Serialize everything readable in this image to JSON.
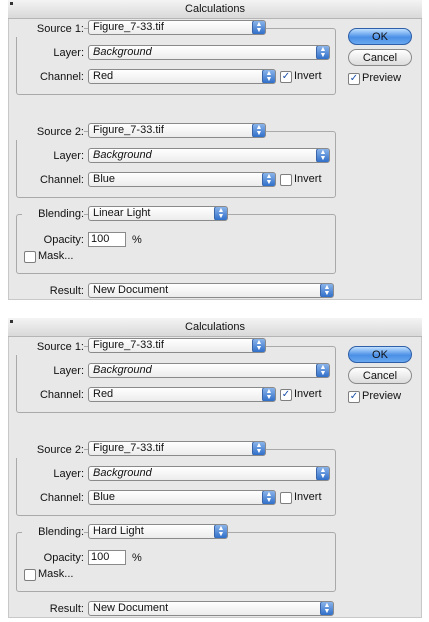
{
  "dialogs": [
    {
      "title": "Calculations",
      "source1": {
        "label": "Source 1:",
        "file": "Figure_7-33.tif",
        "layer_label": "Layer:",
        "layer": "Background",
        "channel_label": "Channel:",
        "channel": "Red",
        "invert_label": "Invert",
        "invert_checked": true
      },
      "source2": {
        "label": "Source 2:",
        "file": "Figure_7-33.tif",
        "layer_label": "Layer:",
        "layer": "Background",
        "channel_label": "Channel:",
        "channel": "Blue",
        "invert_label": "Invert",
        "invert_checked": false
      },
      "blending": {
        "label": "Blending:",
        "mode": "Linear Light",
        "opacity_label": "Opacity:",
        "opacity": "100",
        "percent": "%",
        "mask_label": "Mask...",
        "mask_checked": false
      },
      "result": {
        "label": "Result:",
        "value": "New Document"
      },
      "ok_label": "OK",
      "cancel_label": "Cancel",
      "preview_label": "Preview",
      "preview_checked": true
    },
    {
      "title": "Calculations",
      "source1": {
        "label": "Source 1:",
        "file": "Figure_7-33.tif",
        "layer_label": "Layer:",
        "layer": "Background",
        "channel_label": "Channel:",
        "channel": "Red",
        "invert_label": "Invert",
        "invert_checked": true
      },
      "source2": {
        "label": "Source 2:",
        "file": "Figure_7-33.tif",
        "layer_label": "Layer:",
        "layer": "Background",
        "channel_label": "Channel:",
        "channel": "Blue",
        "invert_label": "Invert",
        "invert_checked": false
      },
      "blending": {
        "label": "Blending:",
        "mode": "Hard Light",
        "opacity_label": "Opacity:",
        "opacity": "100",
        "percent": "%",
        "mask_label": "Mask...",
        "mask_checked": false
      },
      "result": {
        "label": "Result:",
        "value": "New Document"
      },
      "ok_label": "OK",
      "cancel_label": "Cancel",
      "preview_label": "Preview",
      "preview_checked": true
    }
  ],
  "check_glyph": "✓",
  "arrow_glyph": "▲▼"
}
